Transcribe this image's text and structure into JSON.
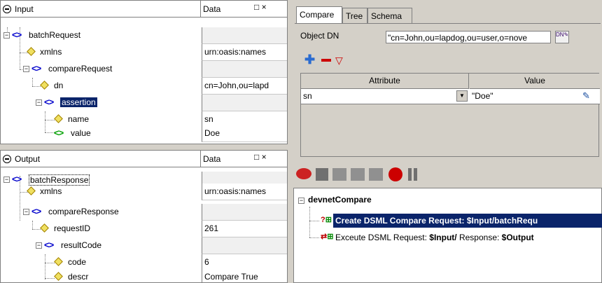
{
  "input_panel": {
    "title": "Input",
    "data_header": "Data",
    "rows": [
      {
        "label": "batchRequest",
        "value": ""
      },
      {
        "label": "xmlns",
        "value": "urn:oasis:names"
      },
      {
        "label": "compareRequest",
        "value": ""
      },
      {
        "label": "dn",
        "value": "cn=John,ou=lapd"
      },
      {
        "label": "assertion",
        "value": ""
      },
      {
        "label": "name",
        "value": "sn"
      },
      {
        "label": "value",
        "value": "Doe"
      }
    ]
  },
  "output_panel": {
    "title": "Output",
    "data_header": "Data",
    "rows": [
      {
        "label": "batchResponse",
        "value": ""
      },
      {
        "label": "xmlns",
        "value": "urn:oasis:names"
      },
      {
        "label": "compareResponse",
        "value": ""
      },
      {
        "label": "requestID",
        "value": "261"
      },
      {
        "label": "resultCode",
        "value": ""
      },
      {
        "label": "code",
        "value": "6"
      },
      {
        "label": "descr",
        "value": "Compare True"
      }
    ]
  },
  "compare_panel": {
    "tabs": [
      "Compare",
      "Tree",
      "Schema"
    ],
    "object_dn_label": "Object DN",
    "object_dn_value": "\"cn=John,ou=lapdog,ou=user,o=nove",
    "table_headers": {
      "attribute": "Attribute",
      "value": "Value"
    },
    "table_rows": [
      {
        "attribute": "sn",
        "value": "\"Doe\""
      }
    ]
  },
  "flow_panel": {
    "root": "devnetCompare",
    "items": [
      {
        "label": "Create DSML Compare Request: $Input/batchRequ"
      },
      {
        "label_pre": "Exceute DSML Request: ",
        "label_b1": "$Input/",
        "label_mid": " Response: ",
        "label_b2": "$Output"
      }
    ]
  },
  "icons": {
    "window_controls": "□ ×"
  }
}
